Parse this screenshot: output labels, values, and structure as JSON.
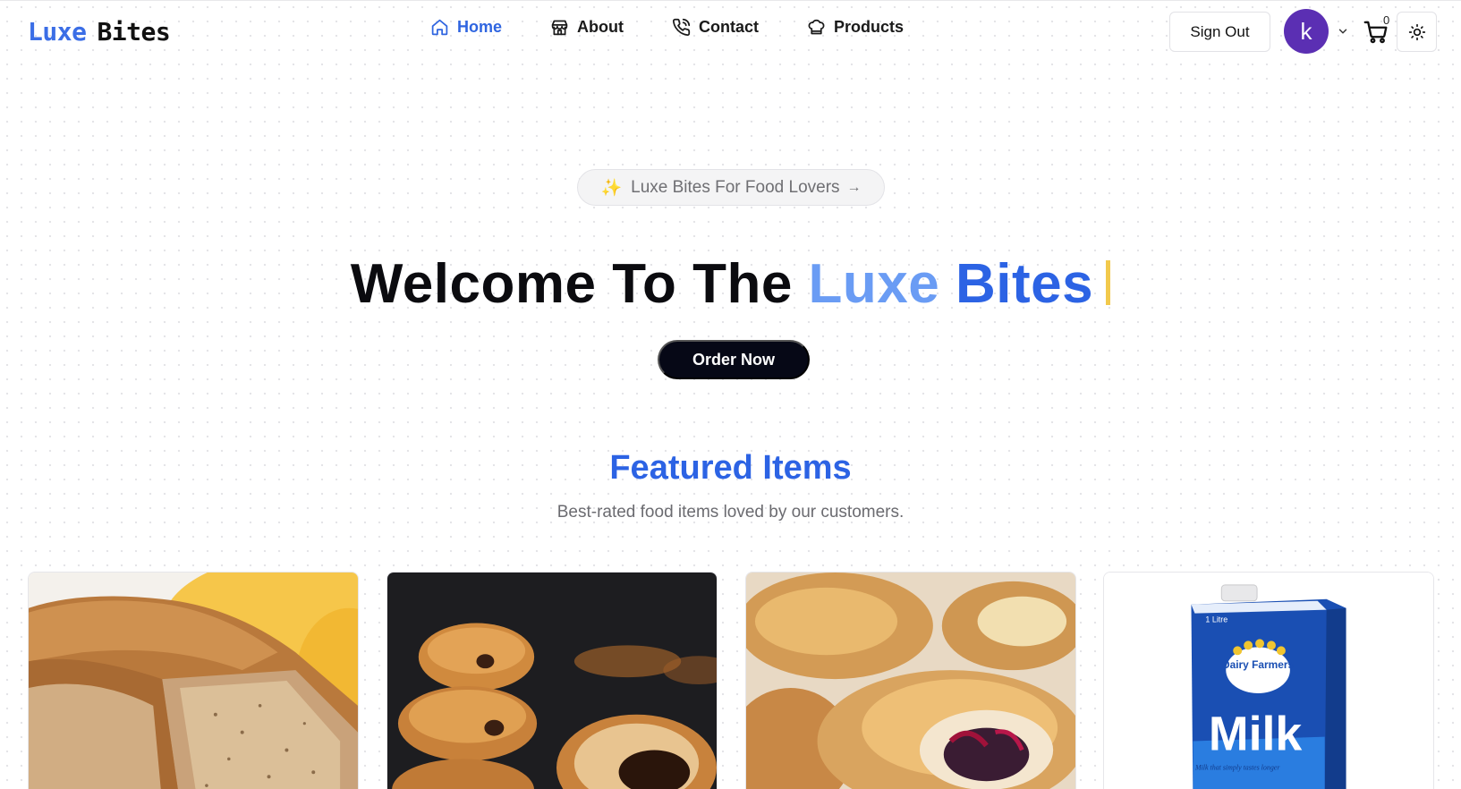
{
  "brand": {
    "part1": "Luxe",
    "part2": "Bites",
    "accent": "#2c63e4"
  },
  "nav": {
    "items": [
      {
        "label": "Home",
        "icon": "home-icon",
        "active": true
      },
      {
        "label": "About",
        "icon": "store-icon",
        "active": false
      },
      {
        "label": "Contact",
        "icon": "phone-icon",
        "active": false
      },
      {
        "label": "Products",
        "icon": "chef-hat-icon",
        "active": false
      }
    ]
  },
  "header": {
    "sign_out_label": "Sign Out",
    "avatar_initial": "k",
    "cart_count": "0"
  },
  "hero": {
    "pill_label": "Luxe Bites For Food Lovers",
    "title_prefix": "Welcome To The",
    "title_word1": "Luxe",
    "title_word2": "Bites",
    "cta_label": "Order Now"
  },
  "featured": {
    "title": "Featured Items",
    "subtitle": "Best-rated food items loved by our customers.",
    "items": [
      {
        "image": "banana-bread-image"
      },
      {
        "image": "chocolate-croissants-image"
      },
      {
        "image": "danish-pastries-image"
      },
      {
        "image": "milk-carton-image",
        "carton_text": {
          "volume": "1 Litre",
          "brand": "Dairy Farmers",
          "product": "Milk",
          "tagline": "Milk that simply tastes longer"
        }
      }
    ]
  }
}
